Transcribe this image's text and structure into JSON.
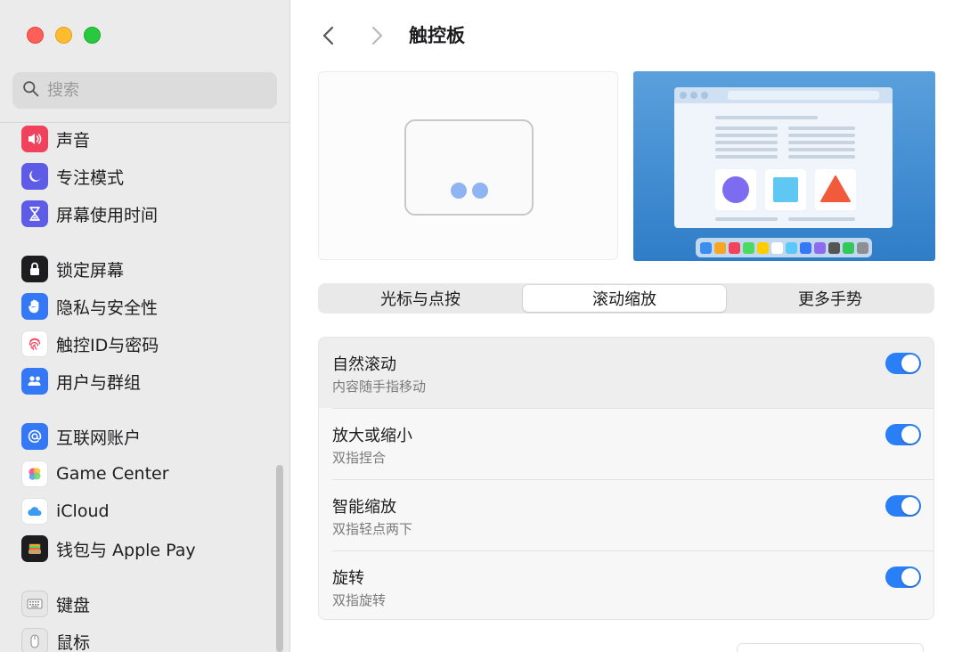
{
  "window": {
    "title": "触控板"
  },
  "search": {
    "placeholder": "搜索"
  },
  "sidebar": {
    "items": [
      {
        "label": "声音",
        "icon": "speaker-icon",
        "color": "#f0415d"
      },
      {
        "label": "专注模式",
        "icon": "moon-icon",
        "color": "#5e5ce6"
      },
      {
        "label": "屏幕使用时间",
        "icon": "hourglass-icon",
        "color": "#5e5ce6"
      },
      {
        "label": "锁定屏幕",
        "icon": "lock-icon",
        "color": "#1d1d1f"
      },
      {
        "label": "隐私与安全性",
        "icon": "hand-icon",
        "color": "#3478f6"
      },
      {
        "label": "触控ID与密码",
        "icon": "fingerprint-icon",
        "color": "#ffffff"
      },
      {
        "label": "用户与群组",
        "icon": "users-icon",
        "color": "#3478f6"
      },
      {
        "label": "互联网账户",
        "icon": "at-icon",
        "color": "#3478f6"
      },
      {
        "label": "Game Center",
        "icon": "game-center-icon",
        "color": "#ffffff"
      },
      {
        "label": "iCloud",
        "icon": "cloud-icon",
        "color": "#ffffff"
      },
      {
        "label": "钱包与 Apple Pay",
        "icon": "wallet-icon",
        "color": "#1d1d1f"
      },
      {
        "label": "键盘",
        "icon": "keyboard-icon",
        "color": "#a0a0a0"
      },
      {
        "label": "鼠标",
        "icon": "mouse-icon",
        "color": "#a0a0a0"
      }
    ]
  },
  "tabs": [
    {
      "label": "光标与点按",
      "active": false
    },
    {
      "label": "滚动缩放",
      "active": true
    },
    {
      "label": "更多手势",
      "active": false
    }
  ],
  "settings": [
    {
      "title": "自然滚动",
      "subtitle": "内容随手指移动",
      "enabled": true
    },
    {
      "title": "放大或缩小",
      "subtitle": "双指捏合",
      "enabled": true
    },
    {
      "title": "智能缩放",
      "subtitle": "双指轻点两下",
      "enabled": true
    },
    {
      "title": "旋转",
      "subtitle": "双指旋转",
      "enabled": true
    }
  ],
  "colors": {
    "accent": "#2b7ff6",
    "sidebar_bg": "#ebebeb"
  }
}
